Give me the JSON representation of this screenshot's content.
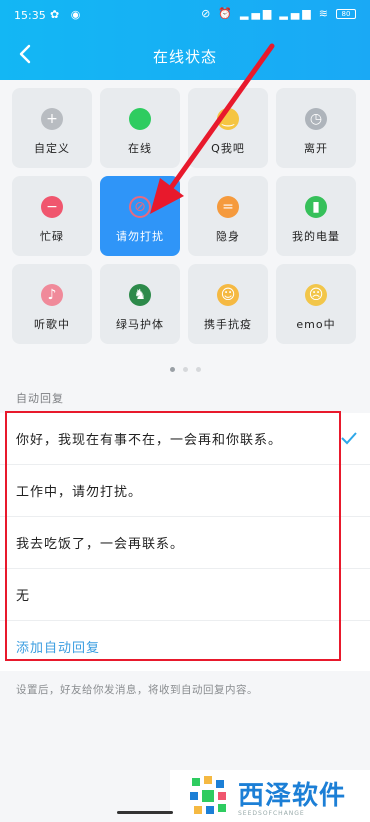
{
  "status_bar": {
    "time": "15:35",
    "battery": "80"
  },
  "header": {
    "title": "在线状态"
  },
  "statuses": [
    {
      "label": "自定义",
      "icon": "plus-icon",
      "color": "#b8bcc1",
      "glyph": "+"
    },
    {
      "label": "在线",
      "icon": "online-dot-icon",
      "color": "#2ecc60",
      "glyph": ""
    },
    {
      "label": "Q我吧",
      "icon": "wink-face-icon",
      "color": "#f5c542",
      "glyph": "‿"
    },
    {
      "label": "离开",
      "icon": "clock-icon",
      "color": "#aeb4bb",
      "glyph": "◷"
    },
    {
      "label": "忙碌",
      "icon": "busy-minus-icon",
      "color": "#f0566e",
      "glyph": "−"
    },
    {
      "label": "请勿打扰",
      "icon": "do-not-disturb-icon",
      "color": "#e86a80",
      "glyph": "⊘",
      "active": true
    },
    {
      "label": "隐身",
      "icon": "invisible-icon",
      "color": "#f59a3d",
      "glyph": "="
    },
    {
      "label": "我的电量",
      "icon": "battery-icon",
      "color": "#36c05a",
      "glyph": "▮"
    },
    {
      "label": "听歌中",
      "icon": "headphones-face-icon",
      "color": "#f08a9a",
      "glyph": "♪"
    },
    {
      "label": "绿马护体",
      "icon": "green-horse-icon",
      "color": "#2d8a4a",
      "glyph": "♞"
    },
    {
      "label": "携手抗疫",
      "icon": "mask-face-icon",
      "color": "#f5b942",
      "glyph": "☺"
    },
    {
      "label": "emo中",
      "icon": "sad-face-icon",
      "color": "#f2c64a",
      "glyph": "☹"
    }
  ],
  "auto_reply": {
    "section_label": "自动回复",
    "items": [
      "你好，我现在有事不在，一会再和你联系。",
      "工作中，请勿打扰。",
      "我去吃饭了，一会再联系。",
      "无"
    ],
    "add_label": "添加自动回复",
    "footnote": "设置后，好友给你发消息，将收到自动回复内容。"
  },
  "watermark": {
    "name": "西泽软件",
    "sub": "SEEDSOFCHANGE"
  },
  "colors": {
    "accent": "#1aa9f5",
    "highlight": "#e8192c",
    "active_tile": "#2f95f8"
  }
}
